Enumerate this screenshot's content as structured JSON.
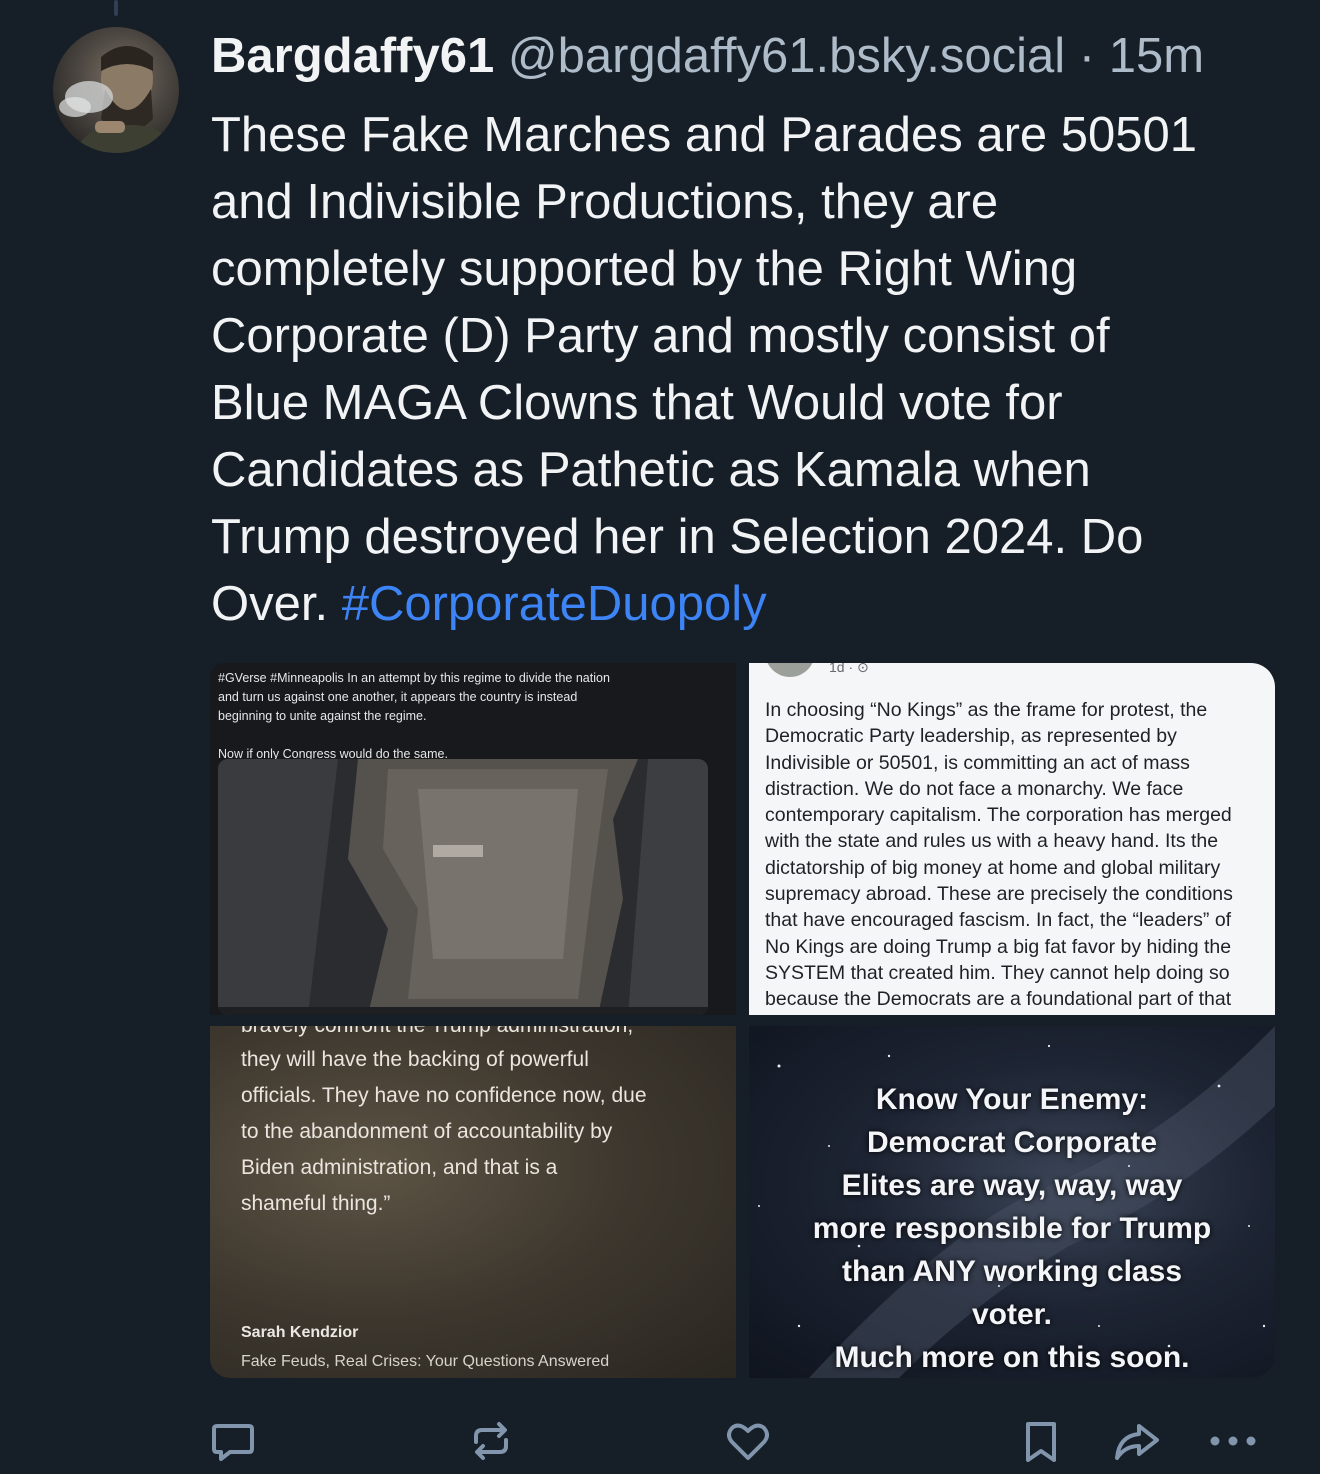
{
  "post": {
    "display_name": "Bargdaffy61",
    "handle": "@bargdaffy61.bsky.social",
    "separator": "·",
    "time": "15m",
    "text_lines": [
      "These Fake Marches and Parades are 50501",
      "and Indivisible Productions, they are",
      "completely supported by the Right Wing",
      "Corporate (D) Party and mostly consist of",
      "Blue MAGA Clowns that Would vote for",
      "Candidates as Pathetic as Kamala when",
      "Trump destroyed her in Selection 2024. Do"
    ],
    "last_line_text": "Over.",
    "hashtag": "#CorporateDuopoly",
    "colors": {
      "link": "#3d84f7",
      "background": "#161e27",
      "muted": "#aebbc9"
    }
  },
  "media": {
    "image1": {
      "caption_lines": [
        "#GVerse #Minneapolis In an attempt by this regime to divide the nation",
        "and turn us against one another, it appears the country is instead",
        "beginning to unite against the regime."
      ],
      "caption_line2": "Now if only Congress would do the same."
    },
    "image2": {
      "meta": "1d · ⊙",
      "lines": [
        "In choosing “No Kings” as the frame for protest, the",
        "Democratic Party leadership, as represented by",
        "Indivisible or 50501, is committing an act of mass",
        "distraction. We do not face a monarchy. We face",
        "contemporary capitalism. The corporation has merged",
        "with the state and rules us with a heavy hand. Its the",
        "dictatorship of big money at home and global military",
        "supremacy abroad. These are precisely the conditions",
        "that have encouraged fascism. In fact, the “leaders” of",
        "No Kings are doing Trump a big fat favor by hiding the",
        "SYSTEM that created him. They cannot help doing so",
        "because the Democrats are a foundational part of that"
      ]
    },
    "image3": {
      "cut_line": "bravely confront the Trump administration,",
      "lines": [
        "they will have the backing of powerful",
        "officials. They have no confidence now, due",
        "to the abandonment of accountability by",
        "Biden administration, and that is a",
        "shameful thing.”"
      ],
      "author": "Sarah Kendzior",
      "source": "Fake Feuds, Real Crises: Your Questions Answered"
    },
    "image4": {
      "lines": [
        "Know Your Enemy:",
        "Democrat Corporate",
        "Elites are way, way, way",
        "more responsible for Trump",
        "than ANY working class",
        "voter.",
        "Much more on this soon."
      ]
    }
  },
  "actions": {
    "reply_icon": "speech-bubble-icon",
    "repost_icon": "repost-arrows-icon",
    "like_icon": "heart-icon",
    "bookmark_icon": "bookmark-icon",
    "share_icon": "share-arrow-icon",
    "more_icon": "ellipsis-icon"
  }
}
